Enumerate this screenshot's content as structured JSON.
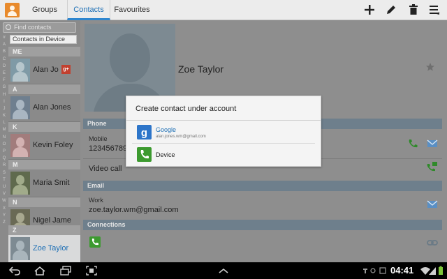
{
  "tabs": [
    {
      "label": "Groups"
    },
    {
      "label": "Contacts",
      "active": true
    },
    {
      "label": "Favourites"
    }
  ],
  "toolbar_icons": [
    "plus-icon",
    "pencil-icon",
    "trash-icon",
    "menu-icon"
  ],
  "left": {
    "search_placeholder": "Find contacts",
    "contacts_in_device": "Contacts in Device",
    "alphabet": [
      "#",
      "A",
      "B",
      "C",
      "D",
      "E",
      "F",
      "G",
      "H",
      "I",
      "J",
      "K",
      "L",
      "M",
      "N",
      "O",
      "P",
      "Q",
      "R",
      "S",
      "T",
      "U",
      "V",
      "W",
      "X",
      "Y",
      "Z"
    ],
    "sections": [
      {
        "header": "ME",
        "name": "Alan Jo",
        "badge": "g+"
      },
      {
        "header": "A",
        "name": "Alan Jones"
      },
      {
        "header": "K",
        "name": "Kevin Foley"
      },
      {
        "header": "M",
        "name": "Maria Smit"
      },
      {
        "header": "N",
        "name": "Nigel Jame"
      },
      {
        "header": "Z",
        "name": "Zoe Taylor",
        "selected": true
      }
    ]
  },
  "detail": {
    "name": "Zoe Taylor",
    "phone_header": "Phone",
    "mobile_label": "Mobile",
    "mobile_value": "123456789",
    "video_call": "Video call",
    "email_header": "Email",
    "work_label": "Work",
    "email_value": "zoe.taylor.wm@gmail.com",
    "connections_header": "Connections"
  },
  "dialog": {
    "title": "Create contact under account",
    "options": [
      {
        "name": "Google",
        "sub": "alan.jones.wm@gmail.com"
      },
      {
        "name": "Device"
      }
    ]
  },
  "status": {
    "clock": "04:41"
  },
  "colors": {
    "accent": "#2e86cf",
    "section_header": "#6e7f8c",
    "google_blue": "#2d75c9",
    "phone_green": "#3c9a2f",
    "app_orange": "#e88a2c"
  }
}
